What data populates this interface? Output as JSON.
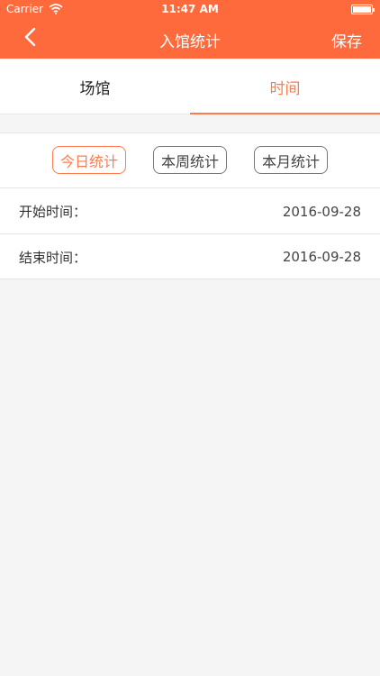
{
  "status_bar": {
    "carrier": "Carrier",
    "time": "11:47 AM"
  },
  "nav": {
    "back_icon": "chevron-left-icon",
    "title": "入馆统计",
    "save_label": "保存"
  },
  "tabs": [
    {
      "label": "场馆",
      "active": false
    },
    {
      "label": "时间",
      "active": true
    }
  ],
  "period_buttons": [
    {
      "label": "今日统计",
      "active": true
    },
    {
      "label": "本周统计",
      "active": false
    },
    {
      "label": "本月统计",
      "active": false
    }
  ],
  "fields": {
    "start_label": "开始时间：",
    "start_value": "2016-09-28",
    "end_label": "结束时间：",
    "end_value": "2016-09-28"
  },
  "colors": {
    "accent": "#ff6a3d",
    "tab_active": "#ff7b4f"
  }
}
